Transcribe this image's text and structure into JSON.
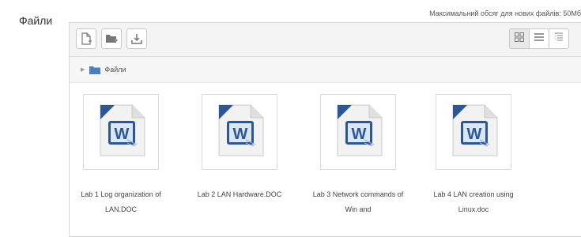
{
  "section": {
    "label": "Файли"
  },
  "max_size_text": "Максимальний обсяг для нових файлів: 50Мб",
  "toolbar": {
    "buttons": [
      {
        "name": "add-file",
        "icon": "add-file-icon"
      },
      {
        "name": "create-folder",
        "icon": "folder-plus-icon"
      },
      {
        "name": "download",
        "icon": "download-icon"
      }
    ],
    "views": [
      {
        "name": "icons-view",
        "icon": "grid-icon",
        "active": true
      },
      {
        "name": "list-view",
        "icon": "list-icon",
        "active": false
      },
      {
        "name": "tree-view",
        "icon": "tree-icon",
        "active": false
      }
    ]
  },
  "breadcrumb": {
    "label": "Файли"
  },
  "files": [
    {
      "name": "Lab 1 Log organization of LAN.DOC",
      "icon": "word-doc-icon"
    },
    {
      "name": "Lab 2 LAN Hardware.DOC",
      "icon": "word-doc-icon"
    },
    {
      "name": "Lab 3 Network commands of Win and",
      "icon": "word-doc-icon"
    },
    {
      "name": "Lab 4 LAN creation using Linux.doc",
      "icon": "word-doc-icon"
    }
  ],
  "colors": {
    "word_blue": "#2b5797",
    "folder_blue": "#4a7fc1"
  }
}
